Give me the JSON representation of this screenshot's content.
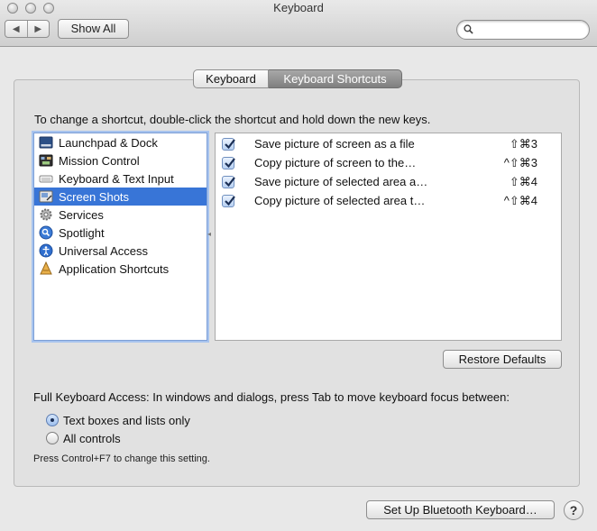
{
  "window": {
    "title": "Keyboard"
  },
  "toolbar": {
    "back": "◀",
    "forward": "▶",
    "show_all_label": "Show All",
    "search_placeholder": "",
    "search_value": ""
  },
  "tabs": [
    {
      "label": "Keyboard",
      "selected": false
    },
    {
      "label": "Keyboard Shortcuts",
      "selected": true
    }
  ],
  "instruction": "To change a shortcut, double-click the shortcut and hold down the new keys.",
  "categories": [
    {
      "label": "Launchpad & Dock",
      "icon": "launchpad-dock-icon",
      "selected": false
    },
    {
      "label": "Mission Control",
      "icon": "mission-control-icon",
      "selected": false
    },
    {
      "label": "Keyboard & Text Input",
      "icon": "keyboard-icon",
      "selected": false
    },
    {
      "label": "Screen Shots",
      "icon": "screenshot-icon",
      "selected": true
    },
    {
      "label": "Services",
      "icon": "gear-icon",
      "selected": false
    },
    {
      "label": "Spotlight",
      "icon": "spotlight-icon",
      "selected": false
    },
    {
      "label": "Universal Access",
      "icon": "accessibility-icon",
      "selected": false
    },
    {
      "label": "Application Shortcuts",
      "icon": "app-shortcuts-icon",
      "selected": false
    }
  ],
  "shortcuts": [
    {
      "checked": true,
      "label": "Save picture of screen as a file",
      "keys": "⇧⌘3"
    },
    {
      "checked": true,
      "label": "Copy picture of screen to the…",
      "keys": "^⇧⌘3"
    },
    {
      "checked": true,
      "label": "Save picture of selected area a…",
      "keys": "⇧⌘4"
    },
    {
      "checked": true,
      "label": "Copy picture of selected area t…",
      "keys": "^⇧⌘4"
    }
  ],
  "restore_defaults_label": "Restore Defaults",
  "full_keyboard_access": {
    "label": "Full Keyboard Access: In windows and dialogs, press Tab to move keyboard focus between:",
    "options": [
      {
        "label": "Text boxes and lists only",
        "selected": true
      },
      {
        "label": "All controls",
        "selected": false
      }
    ],
    "note": "Press Control+F7 to change this setting."
  },
  "bluetooth_button_label": "Set Up Bluetooth Keyboard…",
  "help_label": "?",
  "colors": {
    "selection": "#3875d7",
    "checkbox_check": "#1b2f55"
  }
}
